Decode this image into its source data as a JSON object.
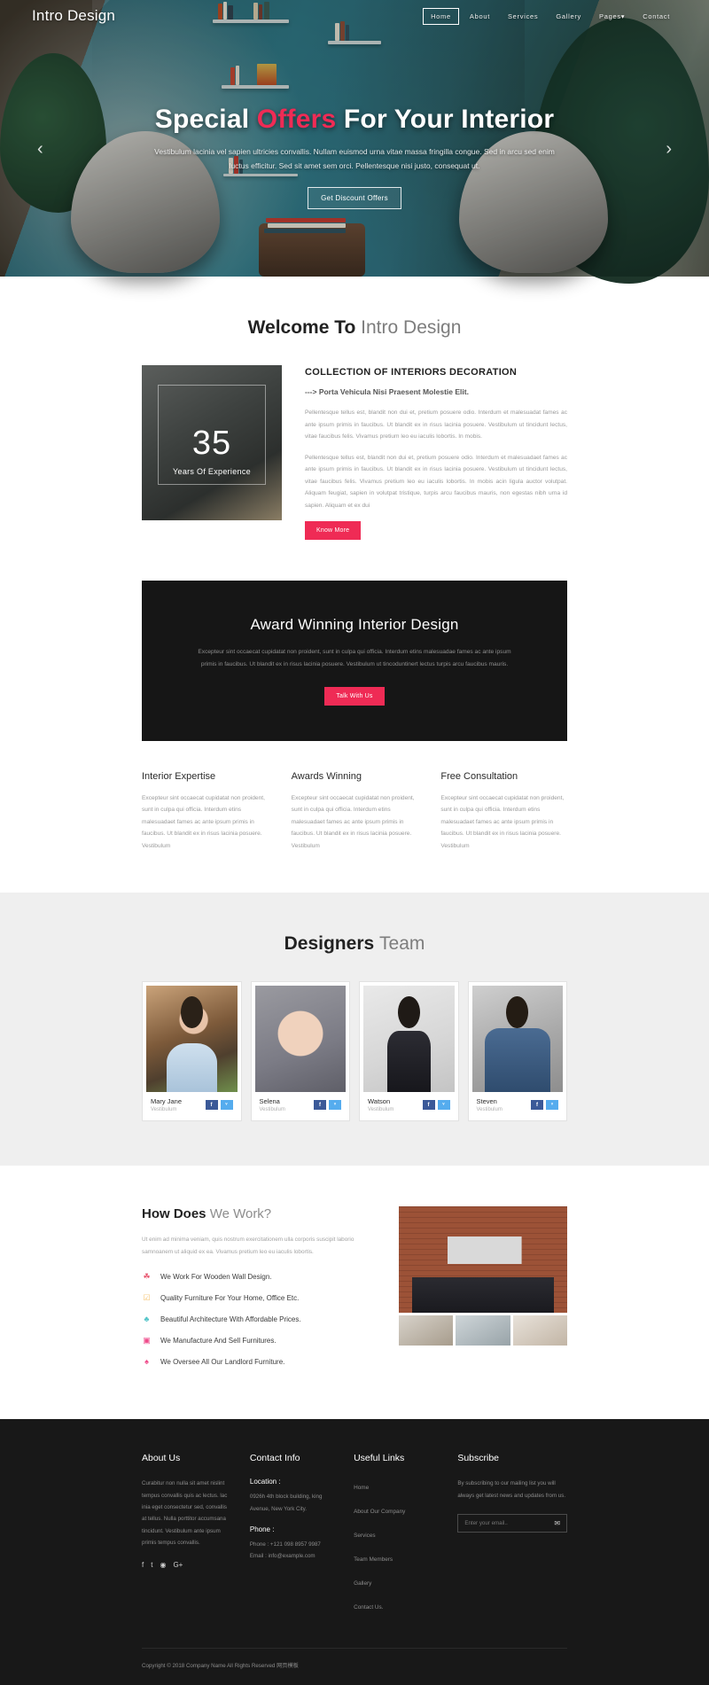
{
  "brand": "Intro Design",
  "nav": {
    "items": [
      {
        "label": "Home",
        "active": true
      },
      {
        "label": "About",
        "active": false
      },
      {
        "label": "Services",
        "active": false
      },
      {
        "label": "Gallery",
        "active": false
      },
      {
        "label": "Pages",
        "active": false,
        "caret": true
      },
      {
        "label": "Contact",
        "active": false
      }
    ]
  },
  "hero": {
    "title_part1": "Special ",
    "title_accent": "Offers",
    "title_part2": " For Your Interior",
    "subtitle": "Vestibulum lacinia vel sapien ultricies convallis. Nullam euismod urna vitae massa fringilla congue. Sed in arcu sed enim luctus efficitur. Sed sit amet sem orci. Pellentesque nisi justo, consequat ut.",
    "button": "Get Discount Offers",
    "prev_icon": "‹",
    "next_icon": "›"
  },
  "welcome": {
    "title_bold": "Welcome To ",
    "title_light": "Intro Design",
    "experience_number": "35",
    "experience_label": "Years Of Experience",
    "heading": "COLLECTION OF INTERIORS DECORATION",
    "subheading": "---> Porta Vehicula Nisi Praesent Molestie Elit.",
    "paragraph1": "Pellentesque tellus est, blandit non dui et, pretium posuere odio. Interdum et malesuadat fames ac ante ipsum primis in faucibus. Ut blandit ex in risus lacinia posuere. Vestibulum ut tincidunt lectus, vitae faucibus felis. Vivamus pretium leo eu iaculis lobortis. In mobis.",
    "paragraph2": "Pellentesque tellus est, blandit non dui et, pretium posuere odio. Interdum et malesuadaet fames ac ante ipsum primis in faucibus. Ut blandit ex in risus lacinia posuere. Vestibulum ut tincidunt lectus, vitae faucibus felis. Vivamus pretium leo eu iaculis lobortis. In mobis acin ligula auctor volutpat. Aliquam feugiat, sapien in volutpat tristique, turpis arcu faucibus mauris, non egestas nibh urna id sapien. Aliquam et ex dui",
    "button": "Know More"
  },
  "award": {
    "heading": "Award Winning Interior Design",
    "paragraph": "Excepteur sint occaecat cupidatat non proident, sunt in culpa qui officia. Interdum etins malesuadae fames ac ante ipsum primis in faucibus. Ut blandit ex in risus lacinia posuere. Vestibulum ut tincoduntinert lectus turpis arcu faucibus mauris.",
    "button": "Talk With Us"
  },
  "features": [
    {
      "title": "Interior Expertise",
      "text": "Excepteur sint occaecat cupidatat non proident, sunt in culpa qui officia. Interdum etins malesuadaet fames ac ante ipsum primis in faucibus. Ut blandit ex in risus lacinia posuere. Vestibulum"
    },
    {
      "title": "Awards Winning",
      "text": "Excepteur sint occaecat cupidatat non proident, sunt in culpa qui officia. Interdum etins malesuadaet fames ac ante ipsum primis in faucibus. Ut blandit ex in risus lacinia posuere. Vestibulum"
    },
    {
      "title": "Free Consultation",
      "text": "Excepteur sint occaecat cupidatat non proident, sunt in culpa qui officia. Interdum etins malesuadaet fames ac ante ipsum primis in faucibus. Ut blandit ex in risus lacinia posuere. Vestibulum"
    }
  ],
  "team": {
    "title_bold": "Designers ",
    "title_light": "Team",
    "facebook_glyph": "f",
    "twitter_glyph": "ᵛ",
    "members": [
      {
        "name": "Mary Jane",
        "role": "Vestibulum"
      },
      {
        "name": "Selena",
        "role": "Vestibulum"
      },
      {
        "name": "Watson",
        "role": "Vestibulum"
      },
      {
        "name": "Steven",
        "role": "Vestibulum"
      }
    ]
  },
  "how": {
    "title_bold": "How Does ",
    "title_light": "We Work?",
    "paragraph": "Ut enim ad minima veniam, quis nostrum exercitationem ulla corporis suscipit laborio samnoanem ut aliquid ex ea. Vivamus pretium leo eu iaculis lobortis.",
    "items": [
      {
        "icon": "☘",
        "color": "#e8566f",
        "text": "We Work For Wooden Wall Design."
      },
      {
        "icon": "☑",
        "color": "#f5c26b",
        "text": "Quality Furniture For Your Home, Office Etc."
      },
      {
        "icon": "♣",
        "color": "#4fc3c7",
        "text": "Beautiful Architecture With Affordable Prices."
      },
      {
        "icon": "▣",
        "color": "#ef4a8a",
        "text": "We Manufacture And Sell Furnitures."
      },
      {
        "icon": "♠",
        "color": "#ef4a8a",
        "text": "We Oversee All Our Landlord Furniture."
      }
    ]
  },
  "footer": {
    "about": {
      "title": "About Us",
      "text": "Curabitur non nulla sit amet nislint tempus convallis quis ac lectus. lac inia eget consectetur sed, convallis at tellus. Nulla porttitor accumsana tincidunt. Vestibulum ante ipsum primis tempus convallis.",
      "socials": [
        "f",
        "t",
        "◉",
        "G+"
      ]
    },
    "contact": {
      "title": "Contact Info",
      "location_label": "Location :",
      "location_value": "0926h 4th block building, king Avenue, New York City.",
      "phone_label": "Phone :",
      "phone_value": "Phone : +121 098 8957 9987",
      "email_value": "Email : info@example.com"
    },
    "useful": {
      "title": "Useful Links",
      "links": [
        "Home",
        "About Our Company",
        "Services",
        "Team Members",
        "Gallery",
        "Contact Us."
      ]
    },
    "subscribe": {
      "title": "Subscribe",
      "text": "By subscribing to our mailing list you will always get latest news and updates from us.",
      "placeholder": "Enter your email..",
      "submit_icon": "✉"
    },
    "copyright": "Copyright © 2018 Company Name All Rights Reserved 网页模板"
  }
}
